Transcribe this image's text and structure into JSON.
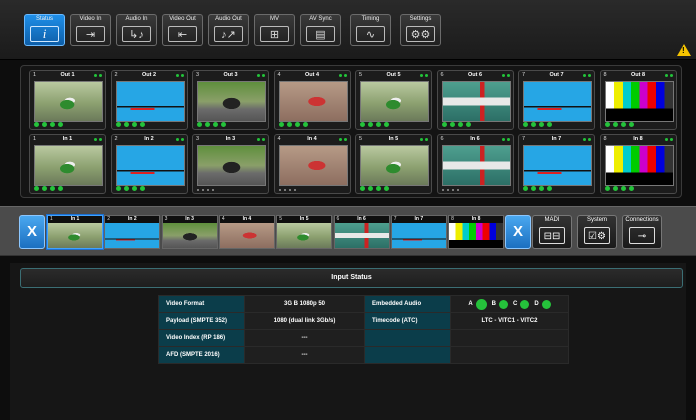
{
  "toolbar": {
    "tabs": [
      {
        "label": "Status",
        "icon": "info-icon",
        "glyph": "i"
      },
      {
        "label": "Video In",
        "icon": "video-in-icon",
        "glyph": "⇥"
      },
      {
        "label": "Audio In",
        "icon": "audio-in-icon",
        "glyph": "↳♪"
      },
      {
        "label": "Video Out",
        "icon": "video-out-icon",
        "glyph": "⇤"
      },
      {
        "label": "Audio Out",
        "icon": "audio-out-icon",
        "glyph": "♪↗"
      },
      {
        "label": "MV",
        "icon": "multiview-icon",
        "glyph": "⊞"
      },
      {
        "label": "AV Sync",
        "icon": "clapper-icon",
        "glyph": "▤"
      },
      {
        "label": "Timing",
        "icon": "timing-icon",
        "glyph": "∿"
      },
      {
        "label": "Settings",
        "icon": "gear-icon",
        "glyph": "⚙⚙"
      }
    ],
    "warning_glyph": "!"
  },
  "outputs": [
    {
      "num": "1",
      "name": "Out 1",
      "img": "moto",
      "active": true
    },
    {
      "num": "2",
      "name": "Out 2",
      "img": "blue",
      "active": true
    },
    {
      "num": "3",
      "name": "Out 3",
      "img": "road",
      "active": true
    },
    {
      "num": "4",
      "name": "Out 4",
      "img": "race",
      "active": true
    },
    {
      "num": "5",
      "name": "Out 5",
      "img": "moto",
      "active": true
    },
    {
      "num": "6",
      "name": "Out 6",
      "img": "green",
      "active": true
    },
    {
      "num": "7",
      "name": "Out 7",
      "img": "blue",
      "active": true
    },
    {
      "num": "8",
      "name": "Out 8",
      "img": "bars",
      "active": true
    }
  ],
  "inputs": [
    {
      "num": "1",
      "name": "In 1",
      "img": "moto",
      "active": true
    },
    {
      "num": "2",
      "name": "In 2",
      "img": "blue",
      "active": true
    },
    {
      "num": "3",
      "name": "In 3",
      "img": "road",
      "active": false
    },
    {
      "num": "4",
      "name": "In 4",
      "img": "race",
      "active": false
    },
    {
      "num": "5",
      "name": "In 5",
      "img": "moto",
      "active": true
    },
    {
      "num": "6",
      "name": "In 6",
      "img": "green",
      "active": false
    },
    {
      "num": "7",
      "name": "In 7",
      "img": "blue",
      "active": true
    },
    {
      "num": "8",
      "name": "In 8",
      "img": "bars",
      "active": true
    }
  ],
  "strip": {
    "close_glyph": "X",
    "items": [
      {
        "num": "1",
        "name": "In 1",
        "img": "moto"
      },
      {
        "num": "2",
        "name": "In 2",
        "img": "blue"
      },
      {
        "num": "3",
        "name": "In 3",
        "img": "road"
      },
      {
        "num": "4",
        "name": "In 4",
        "img": "race"
      },
      {
        "num": "5",
        "name": "In 5",
        "img": "moto"
      },
      {
        "num": "6",
        "name": "In 6",
        "img": "green"
      },
      {
        "num": "7",
        "name": "In 7",
        "img": "blue"
      },
      {
        "num": "8",
        "name": "In 8",
        "img": "bars"
      }
    ],
    "buttons": [
      {
        "label": "MADI",
        "icon": "madi-icon",
        "glyph": "⊟⊟"
      },
      {
        "label": "System",
        "icon": "system-icon",
        "glyph": "☑⚙"
      },
      {
        "label": "Connections",
        "icon": "connections-icon",
        "glyph": "⊸"
      }
    ]
  },
  "status": {
    "title": "Input Status",
    "video_format_label": "Video Format",
    "video_format_value": "3G B 1080p 50",
    "payload_label": "Payload (SMPTE 352)",
    "payload_value": "1080 (dual link 3Gb/s)",
    "video_index_label": "Video Index (RP 186)",
    "video_index_value": "---",
    "afd_label": "AFD (SMPTE 2016)",
    "afd_value": "---",
    "embedded_audio_label": "Embedded Audio",
    "channels": [
      "A",
      "B",
      "C",
      "D"
    ],
    "timecode_label": "Timecode (ATC)",
    "timecode_value": "LTC - VITC1 - VITC2"
  },
  "colors": {
    "accent": "#1f8fe8",
    "led_on": "#25c13b",
    "warning": "#f5c400",
    "table_key": "#0b3d4a"
  }
}
